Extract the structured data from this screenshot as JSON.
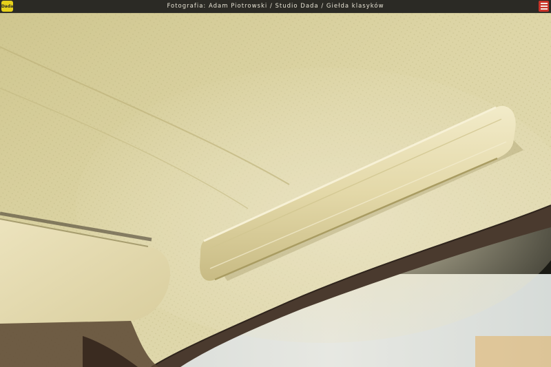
{
  "header": {
    "caption": "Fotografia: Adam Piotrowski / Studio Dada / Giełda klasyków",
    "left_logo_icon": "dada-logo",
    "right_logo_icon": "gielda-klasykow-logo"
  },
  "photo": {
    "subject": "car-headliner-grab-handle",
    "colors": {
      "headliner": "#d8cf9e",
      "handle": "#e6dcae",
      "trim": "#4a3a2e"
    }
  }
}
